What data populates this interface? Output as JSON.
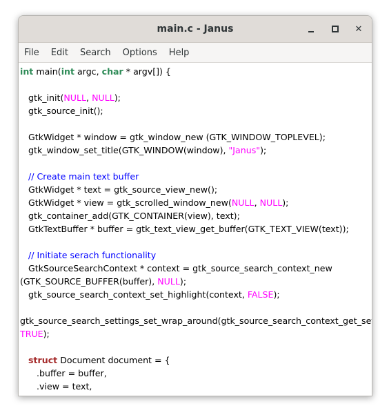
{
  "window": {
    "title": "main.c - Janus",
    "controls": [
      "minimize",
      "maximize",
      "close"
    ]
  },
  "menu": [
    "File",
    "Edit",
    "Search",
    "Options",
    "Help"
  ],
  "colors": {
    "keyword": "#2e8b57",
    "struct_keyword": "#a52a2a",
    "constant": "#ff00ff",
    "comment": "#0000ff"
  },
  "code": [
    [
      [
        "int",
        "kw"
      ],
      [
        " main(",
        ""
      ],
      [
        "int",
        "kw"
      ],
      [
        " argc, ",
        ""
      ],
      [
        "char",
        "kw"
      ],
      [
        " * argv[]) {",
        ""
      ]
    ],
    [],
    [
      [
        "   gtk_init(",
        ""
      ],
      [
        "NULL",
        "const"
      ],
      [
        ", ",
        ""
      ],
      [
        "NULL",
        "const"
      ],
      [
        ");",
        ""
      ]
    ],
    [
      [
        "   gtk_source_init();",
        ""
      ]
    ],
    [],
    [
      [
        "   GtkWidget * window = gtk_window_new (GTK_WINDOW_TOPLEVEL);",
        ""
      ]
    ],
    [
      [
        "   gtk_window_set_title(GTK_WINDOW(window), ",
        ""
      ],
      [
        "\"Janus\"",
        "str"
      ],
      [
        ");",
        ""
      ]
    ],
    [],
    [
      [
        "   // Create main text buffer",
        "cm"
      ]
    ],
    [
      [
        "   GtkWidget * text = gtk_source_view_new();",
        ""
      ]
    ],
    [
      [
        "   GtkWidget * view = gtk_scrolled_window_new(",
        ""
      ],
      [
        "NULL",
        "const"
      ],
      [
        ", ",
        ""
      ],
      [
        "NULL",
        "const"
      ],
      [
        ");",
        ""
      ]
    ],
    [
      [
        "   gtk_container_add(GTK_CONTAINER(view), text);",
        ""
      ]
    ],
    [
      [
        "   GtkTextBuffer * buffer = gtk_text_view_get_buffer(GTK_TEXT_VIEW(text));",
        ""
      ]
    ],
    [],
    [
      [
        "   // Initiate serach functionality",
        "cm"
      ]
    ],
    [
      [
        "   GtkSourceSearchContext * context = gtk_source_search_context_new",
        ""
      ]
    ],
    [
      [
        "(GTK_SOURCE_BUFFER(buffer), ",
        ""
      ],
      [
        "NULL",
        "const"
      ],
      [
        ");",
        ""
      ]
    ],
    [
      [
        "   gtk_source_search_context_set_highlight(context, ",
        ""
      ],
      [
        "FALSE",
        "const"
      ],
      [
        ");",
        ""
      ]
    ],
    [],
    [
      [
        "gtk_source_search_settings_set_wrap_around(gtk_source_search_context_get_settin",
        ""
      ]
    ],
    [
      [
        "TRUE",
        "const"
      ],
      [
        ");",
        ""
      ]
    ],
    [],
    [
      [
        "   ",
        ""
      ],
      [
        "struct",
        "kw2"
      ],
      [
        " Document document = {",
        ""
      ]
    ],
    [
      [
        "      .buffer = buffer,",
        ""
      ]
    ],
    [
      [
        "      .view = text,",
        ""
      ]
    ]
  ]
}
